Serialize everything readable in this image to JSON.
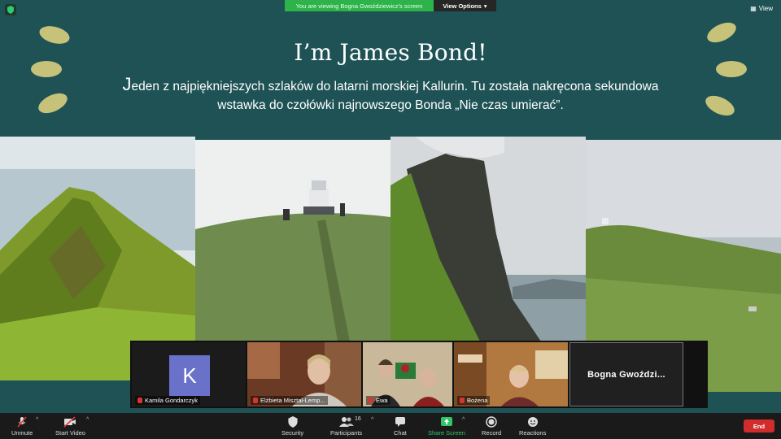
{
  "banner": {
    "message": "You are viewing Bogna Gwoździewicz's screen",
    "view_options": "View Options",
    "view_label": "View"
  },
  "slide": {
    "title": "I’m James Bond!",
    "body_initial": "J",
    "body_line1": "eden z najpiękniejszych szlaków do latarni morskiej Kallurin. Tu została nakręcona sekundowa",
    "body_line2": "wstawka do czołówki najnowszego Bonda „Nie czas umierać”.",
    "colors": {
      "background": "#1e5255",
      "accent_blobs": "#c6c27a"
    }
  },
  "participants": [
    {
      "name": "Kamila Gondarczyk",
      "initial": "K",
      "muted": true
    },
    {
      "name": "Elżbieta Misztal-Lemp...",
      "muted": true
    },
    {
      "name": "Ewa",
      "muted": true
    },
    {
      "name": "Bożena",
      "muted": true
    },
    {
      "name": "Bogna  Gwoździ...",
      "muted": false
    }
  ],
  "toolbar": {
    "unmute": "Unmute",
    "start_video": "Start Video",
    "security": "Security",
    "participants": "Participants",
    "participants_count": "16",
    "chat": "Chat",
    "share_screen": "Share Screen",
    "record": "Record",
    "reactions": "Reactions",
    "end": "End",
    "share_color": "#31c46a",
    "end_color": "#d12c2c"
  }
}
